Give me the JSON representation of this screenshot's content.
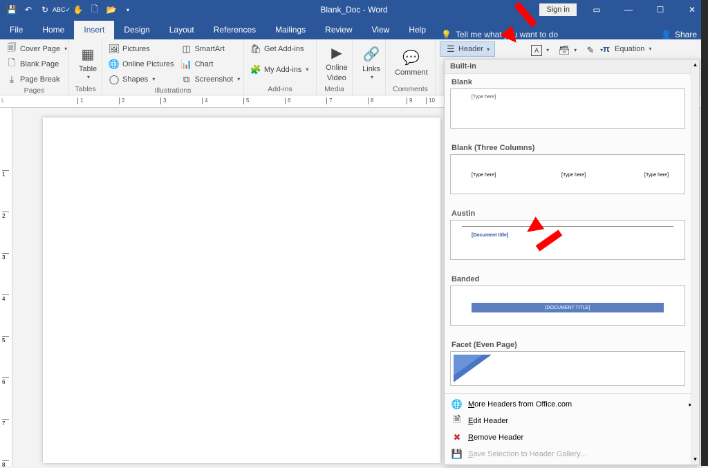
{
  "title": "Blank_Doc - Word",
  "signin": "Sign in",
  "tabs": [
    "File",
    "Home",
    "Insert",
    "Design",
    "Layout",
    "References",
    "Mailings",
    "Review",
    "View",
    "Help"
  ],
  "active_tab": "Insert",
  "tellme": "Tell me what you want to do",
  "share": "Share",
  "ribbon": {
    "pages": {
      "cover": "Cover Page",
      "blank": "Blank Page",
      "break": "Page Break",
      "label": "Pages"
    },
    "tables": {
      "table": "Table",
      "label": "Tables"
    },
    "illus": {
      "pictures": "Pictures",
      "online": "Online Pictures",
      "shapes": "Shapes",
      "smartart": "SmartArt",
      "chart": "Chart",
      "screenshot": "Screenshot",
      "label": "Illustrations"
    },
    "addins": {
      "get": "Get Add-ins",
      "my": "My Add-ins",
      "label": "Add-ins"
    },
    "media": {
      "online_video_l1": "Online",
      "online_video_l2": "Video",
      "label": "Media"
    },
    "links": {
      "links": "Links",
      "label": ""
    },
    "comments": {
      "comment": "Comment",
      "label": "Comments"
    },
    "headerfooter": {
      "header": "Header"
    },
    "symbols": {
      "equation": "Equation"
    }
  },
  "gallery": {
    "section": "Built-in",
    "items": [
      {
        "title": "Blank",
        "sub": [
          "[Type here]"
        ]
      },
      {
        "title": "Blank (Three Columns)",
        "sub": [
          "[Type here]",
          "[Type here]",
          "[Type here]"
        ]
      },
      {
        "title": "Austin",
        "sub": [
          "[Document title]"
        ]
      },
      {
        "title": "Banded",
        "sub": [
          "[DOCUMENT TITLE]"
        ]
      },
      {
        "title": "Facet (Even Page)",
        "sub": []
      }
    ],
    "footer": {
      "more": "More Headers from Office.com",
      "edit": "Edit Header",
      "remove": "Remove Header",
      "save": "Save Selection to Header Gallery..."
    }
  }
}
